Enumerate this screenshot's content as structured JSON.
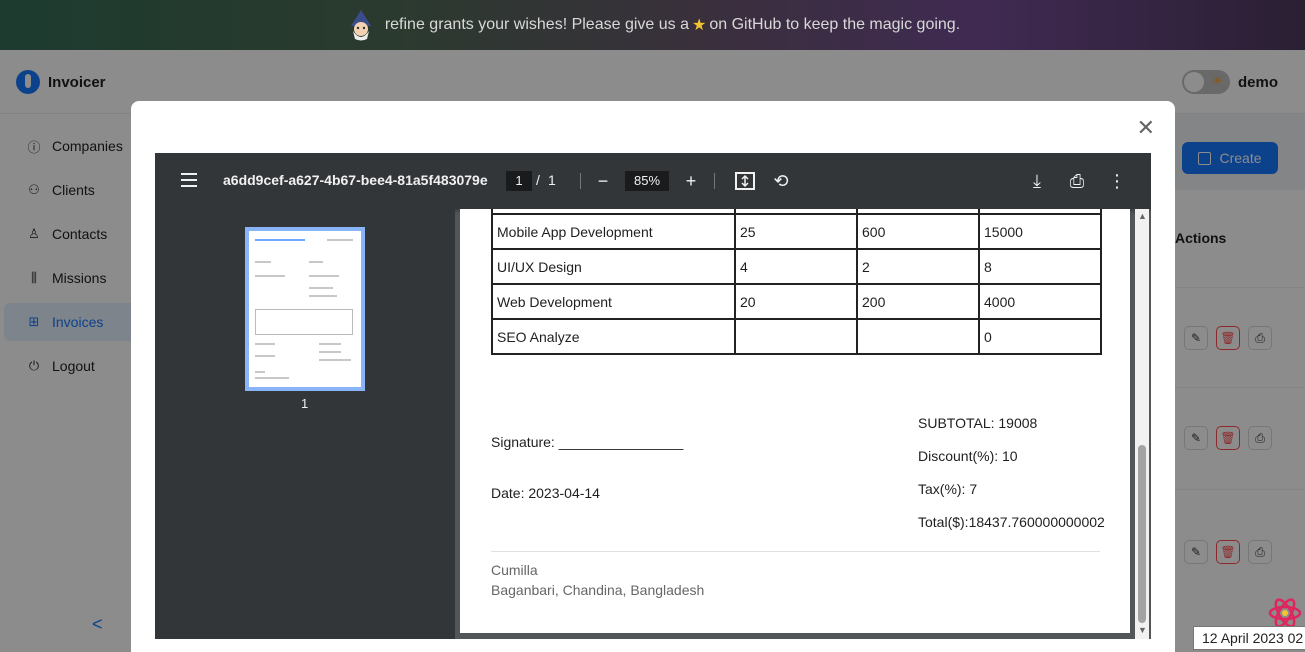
{
  "banner": {
    "text": "refine grants your wishes! Please give us a",
    "star": "★",
    "text2": "on GitHub to keep the magic going."
  },
  "app": {
    "name": "Invoicer",
    "user": "demo"
  },
  "sidebar": {
    "items": [
      {
        "label": "Companies",
        "icon": "info-circle-icon"
      },
      {
        "label": "Clients",
        "icon": "team-icon"
      },
      {
        "label": "Contacts",
        "icon": "user-icon"
      },
      {
        "label": "Missions",
        "icon": "sliders-icon"
      },
      {
        "label": "Invoices",
        "icon": "file-add-icon",
        "active": true
      },
      {
        "label": "Logout",
        "icon": "logout-icon"
      }
    ],
    "collapse": "<"
  },
  "content": {
    "create_label": "Create",
    "actions_header": "Actions"
  },
  "tooltip": {
    "date": "12 April 2023 02"
  },
  "viewer": {
    "filename": "a6dd9cef-a627-4b67-bee4-81a5f483079e",
    "page_current": "1",
    "page_sep": "/",
    "page_total": "1",
    "zoom": "85%",
    "thumbnail_label": "1"
  },
  "invoice": {
    "rows": [
      [
        "Mobile App Development",
        "25",
        "600",
        "15000"
      ],
      [
        "UI/UX Design",
        "4",
        "2",
        "8"
      ],
      [
        "Web Development",
        "20",
        "200",
        "4000"
      ],
      [
        "SEO Analyze",
        "",
        "",
        "0"
      ]
    ],
    "signature": "Signature: ________________",
    "date": "Date: 2023-04-14",
    "subtotal": "SUBTOTAL: 19008",
    "discount": "Discount(%): 10",
    "tax": "Tax(%): 7",
    "total": "Total($):18437.760000000002",
    "footer_city": "Cumilla",
    "footer_address": "Baganbari, Chandina, Bangladesh"
  },
  "colors": {
    "accent": "#1677ff",
    "danger": "#ff4d4f",
    "viewer_bg": "#525659",
    "toolbar_bg": "#323639"
  }
}
